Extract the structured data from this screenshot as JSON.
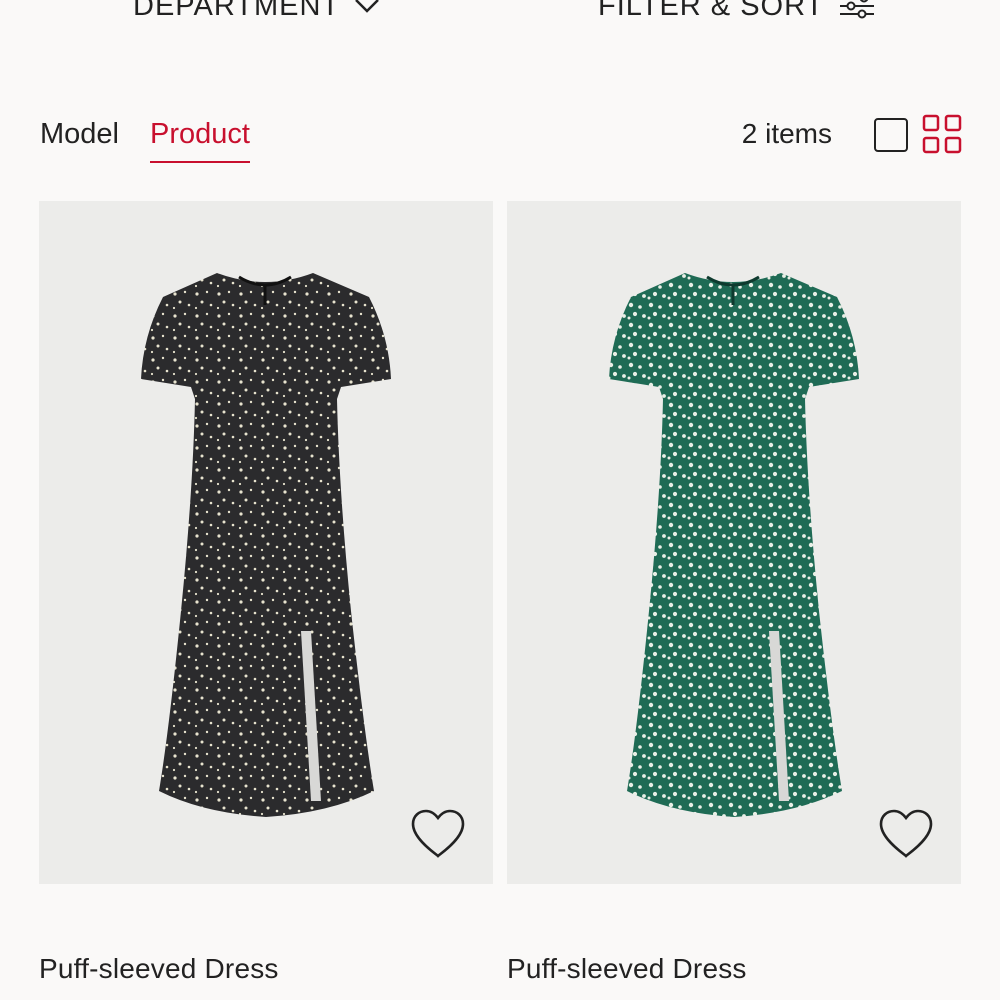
{
  "topbar": {
    "department_label": "DEPARTMENT",
    "filter_sort_label": "FILTER & SORT"
  },
  "view_toggle": {
    "model_label": "Model",
    "product_label": "Product",
    "active": "Product",
    "accent_color": "#c8102e"
  },
  "results": {
    "count_label": "2 items",
    "layout_options": [
      "single-column-icon",
      "grid-four-icon"
    ],
    "active_layout": "grid-four-icon"
  },
  "products": [
    {
      "name": "Puff-sleeved Dress",
      "dress_color": "#2b2b2d",
      "print_color": "#e8e4cf",
      "favorite_icon": "heart-outline-icon"
    },
    {
      "name": "Puff-sleeved Dress",
      "dress_color": "#1f6b55",
      "print_color": "#e9efe6",
      "favorite_icon": "heart-outline-icon"
    }
  ]
}
